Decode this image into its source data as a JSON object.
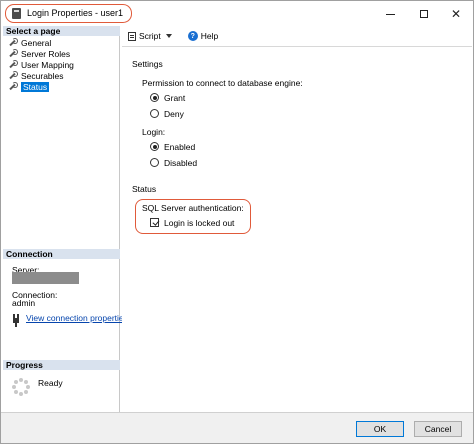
{
  "window": {
    "title": "Login Properties - user1"
  },
  "left_pane": {
    "select_page_header": "Select a page",
    "pages": [
      {
        "label": "General",
        "selected": false
      },
      {
        "label": "Server Roles",
        "selected": false
      },
      {
        "label": "User Mapping",
        "selected": false
      },
      {
        "label": "Securables",
        "selected": false
      },
      {
        "label": "Status",
        "selected": true
      }
    ],
    "connection_header": "Connection",
    "server_label": "Server:",
    "connection_label": "Connection:",
    "connection_value": "admin",
    "view_connection_link": "View connection properties",
    "progress_header": "Progress",
    "progress_status": "Ready"
  },
  "toolbar": {
    "script_label": "Script",
    "help_label": "Help"
  },
  "content": {
    "settings_label": "Settings",
    "permission_label": "Permission to connect to database engine:",
    "grant_label": "Grant",
    "deny_label": "Deny",
    "permission_value": "Grant",
    "login_label": "Login:",
    "enabled_label": "Enabled",
    "disabled_label": "Disabled",
    "login_value": "Enabled",
    "status_label": "Status",
    "sql_auth_label": "SQL Server authentication:",
    "locked_out_label": "Login is locked out",
    "locked_out_checked": true
  },
  "buttons": {
    "ok_label": "OK",
    "cancel_label": "Cancel"
  },
  "colors": {
    "highlight": "#e05a3a",
    "section_header_bg": "#d9e2ee",
    "selection": "#0078d7",
    "link": "#0645ad"
  }
}
